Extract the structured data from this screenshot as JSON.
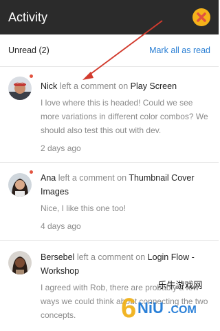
{
  "header": {
    "title": "Activity",
    "close_icon": "close-icon"
  },
  "subheader": {
    "unread_label": "Unread (2)",
    "mark_all_label": "Mark all as read"
  },
  "accent_color": "#2a7fd4",
  "unread_dot_color": "#e2533f",
  "notifications": [
    {
      "name": "Nick",
      "verb": "left a comment on",
      "target": "Play Screen",
      "body": "I love where this is headed! Could we see more variations in different color combos? We should also test this out with dev.",
      "time": "2 days ago",
      "unread": true
    },
    {
      "name": "Ana",
      "verb": "left a comment on",
      "target": "Thumbnail Cover Images",
      "body": "Nice, I like this one too!",
      "time": "4 days ago",
      "unread": true
    },
    {
      "name": "Bersebel",
      "verb": "left a comment on",
      "target": "Login Flow - Workshop",
      "body": "I agreed with Rob, there are probably a few ways we could think about connecting the two concepts.",
      "time": "",
      "unread": false
    }
  ],
  "watermark": {
    "brand": "6NiU.COM",
    "chinese": "乐牛游戏网"
  }
}
